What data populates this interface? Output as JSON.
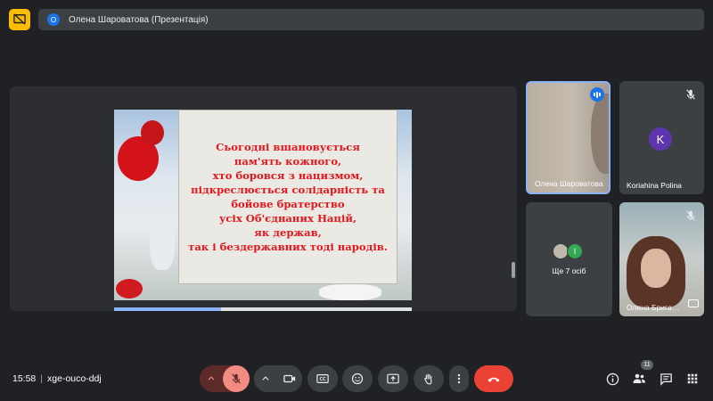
{
  "top_bar": {
    "presenter_initial": "О",
    "presenter_label": "Олена Шароватова (Презентація)"
  },
  "slide": {
    "text": "Сьогодні вшановується\nпам'ять кожного,\nхто боровся з нацизмом,\nпідкреслюється солідарність та\nбойове братерство\nусіх Об'єднаних Націй,\nяк держав,\nтак і бездержавних тоді народів.",
    "text_color": "#e1191e"
  },
  "participants": {
    "tile1": {
      "name": "Олена Шароватова"
    },
    "tile2": {
      "name": "Koriahina Polina",
      "initial": "K"
    },
    "tile3": {
      "label": "Ще 7 осіб",
      "avatar_initial": "I"
    },
    "tile4": {
      "name": "Олена Бригадир"
    }
  },
  "bottom_bar": {
    "time": "15:58",
    "meeting_code": "xge-ouco-ddj",
    "people_count": "11",
    "controls": [
      "mic-off",
      "camera",
      "captions",
      "emoji",
      "present",
      "raise-hand",
      "more",
      "leave-call"
    ]
  },
  "colors": {
    "accent": "#8ab4f8",
    "leave": "#ea4335",
    "mic_off": "#f28b82"
  }
}
